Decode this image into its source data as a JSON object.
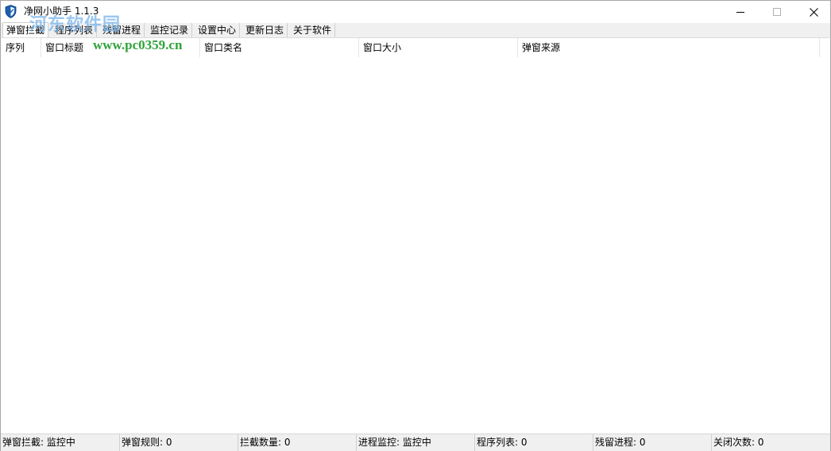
{
  "window": {
    "title": "净网小助手 1.1.3"
  },
  "watermark": {
    "site_name": "河东软件园",
    "url": "www.pc0359.cn"
  },
  "tabs": [
    {
      "label": "弹窗拦截",
      "active": true
    },
    {
      "label": "程序列表",
      "active": false
    },
    {
      "label": "残留进程",
      "active": false
    },
    {
      "label": "监控记录",
      "active": false
    },
    {
      "label": "设置中心",
      "active": false
    },
    {
      "label": "更新日志",
      "active": false
    },
    {
      "label": "关于软件",
      "active": false
    }
  ],
  "table": {
    "columns": [
      "序列",
      "窗口标题",
      "窗口类名",
      "窗口大小",
      "弹窗来源"
    ],
    "rows": []
  },
  "statusbar": [
    "弹窗拦截: 监控中",
    "弹窗规则: 0",
    "拦截数量: 0",
    "进程监控: 监控中",
    "程序列表: 0",
    "残留进程: 0",
    "关闭次数: 0"
  ],
  "icons": {
    "app": "shield-icon",
    "minimize": "minimize-icon",
    "maximize": "maximize-icon",
    "close": "close-icon"
  }
}
